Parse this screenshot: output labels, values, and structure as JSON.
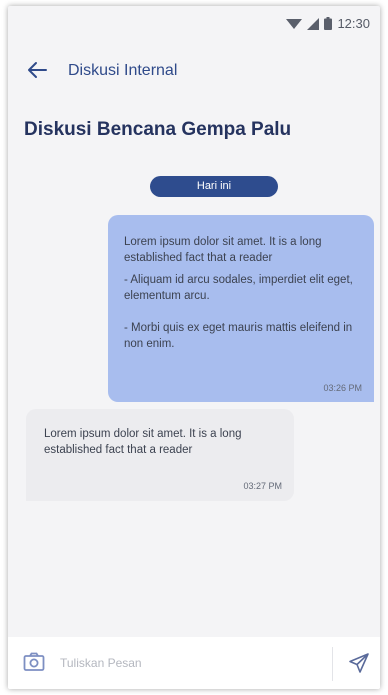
{
  "status_bar": {
    "time": "12:30",
    "icons": [
      "wifi-icon",
      "signal-icon",
      "battery-icon"
    ]
  },
  "app_bar": {
    "back_icon": "arrow-left-icon",
    "title": "Diskusi Internal"
  },
  "page": {
    "title": "Diskusi Bencana Gempa Palu"
  },
  "date_chip": {
    "label": "Hari ini"
  },
  "messages": [
    {
      "direction": "outgoing",
      "paragraphs": [
        "Lorem ipsum dolor sit amet. It is a long established fact that a reader",
        "- Aliquam id arcu sodales, imperdiet elit eget, elementum arcu.",
        "- Morbi quis ex eget mauris mattis eleifend in non enim."
      ],
      "time": "03:26 PM"
    },
    {
      "direction": "incoming",
      "paragraphs": [
        "Lorem ipsum dolor sit amet. It is a long established fact that a reader"
      ],
      "time": "03:27 PM"
    }
  ],
  "composer": {
    "camera_icon": "camera-icon",
    "placeholder": "Tuliskan Pesan",
    "value": "",
    "send_icon": "send-icon"
  },
  "colors": {
    "accent": "#2e4c8e",
    "outgoing_bubble": "#a8bdee",
    "incoming_bubble": "#ececef",
    "background": "#f4f4f6"
  }
}
